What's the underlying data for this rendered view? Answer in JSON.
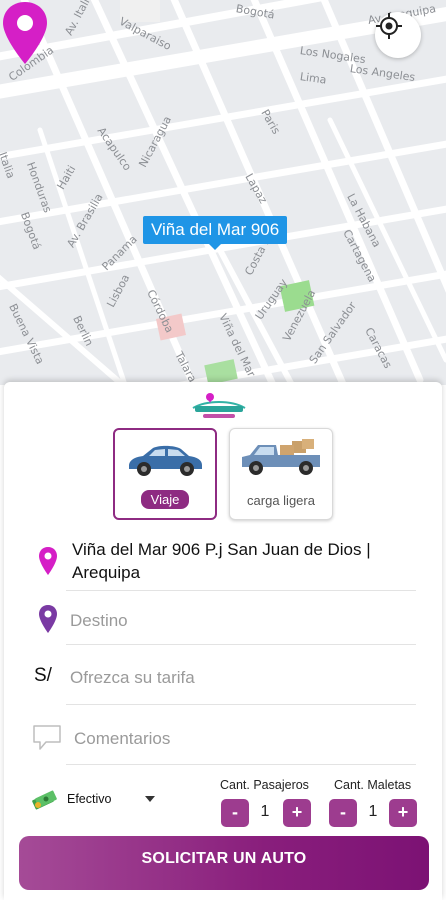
{
  "map": {
    "streets": [
      "Av. Italia",
      "Valparaiso",
      "Bogotá",
      "Av. Arequipa",
      "Colombia",
      "Los Nogales",
      "Lima",
      "Los Angeles",
      "Paris",
      "Acapulco",
      "Italia",
      "Honduras",
      "Haiti",
      "Nicaragua",
      "Lapaz",
      "La Habana",
      "Bogotá",
      "Av. Brasilia",
      "Panama",
      "Cartagena",
      "Lisboa",
      "Córdoba",
      "Costa Rica",
      "Uruguay",
      "Buena Vista",
      "Berlin",
      "Venezuela",
      "San Salvador",
      "Caracas",
      "Viña del Mar",
      "Talara"
    ],
    "callout": "Viña del Mar 906",
    "menu_icon": "hamburger-menu-icon",
    "locate_icon": "crosshair-icon",
    "pin_color": "#d51fc6",
    "callout_color": "#1f95e6"
  },
  "panel": {
    "vehicles": [
      {
        "label": "Viaje",
        "selected": true,
        "icon": "sedan-icon"
      },
      {
        "label": "carga ligera",
        "selected": false,
        "icon": "pickup-truck-icon"
      }
    ],
    "origin": "Viña del Mar 906 P.j San Juan de Dios | Arequipa",
    "destination_placeholder": "Destino",
    "currency_symbol": "S/",
    "fare_placeholder": "Ofrezca su tarifa",
    "comments_placeholder": "Comentarios",
    "payment": {
      "label": "Efectivo",
      "icon": "cash-icon"
    },
    "passengers": {
      "label": "Cant. Pasajeros",
      "value": "1",
      "minus": "-",
      "plus": "+"
    },
    "luggage": {
      "label": "Cant. Maletas",
      "value": "1",
      "minus": "-",
      "plus": "+"
    },
    "submit_label": "SOLICITAR UN AUTO",
    "accent_color": "#8e2b82"
  }
}
